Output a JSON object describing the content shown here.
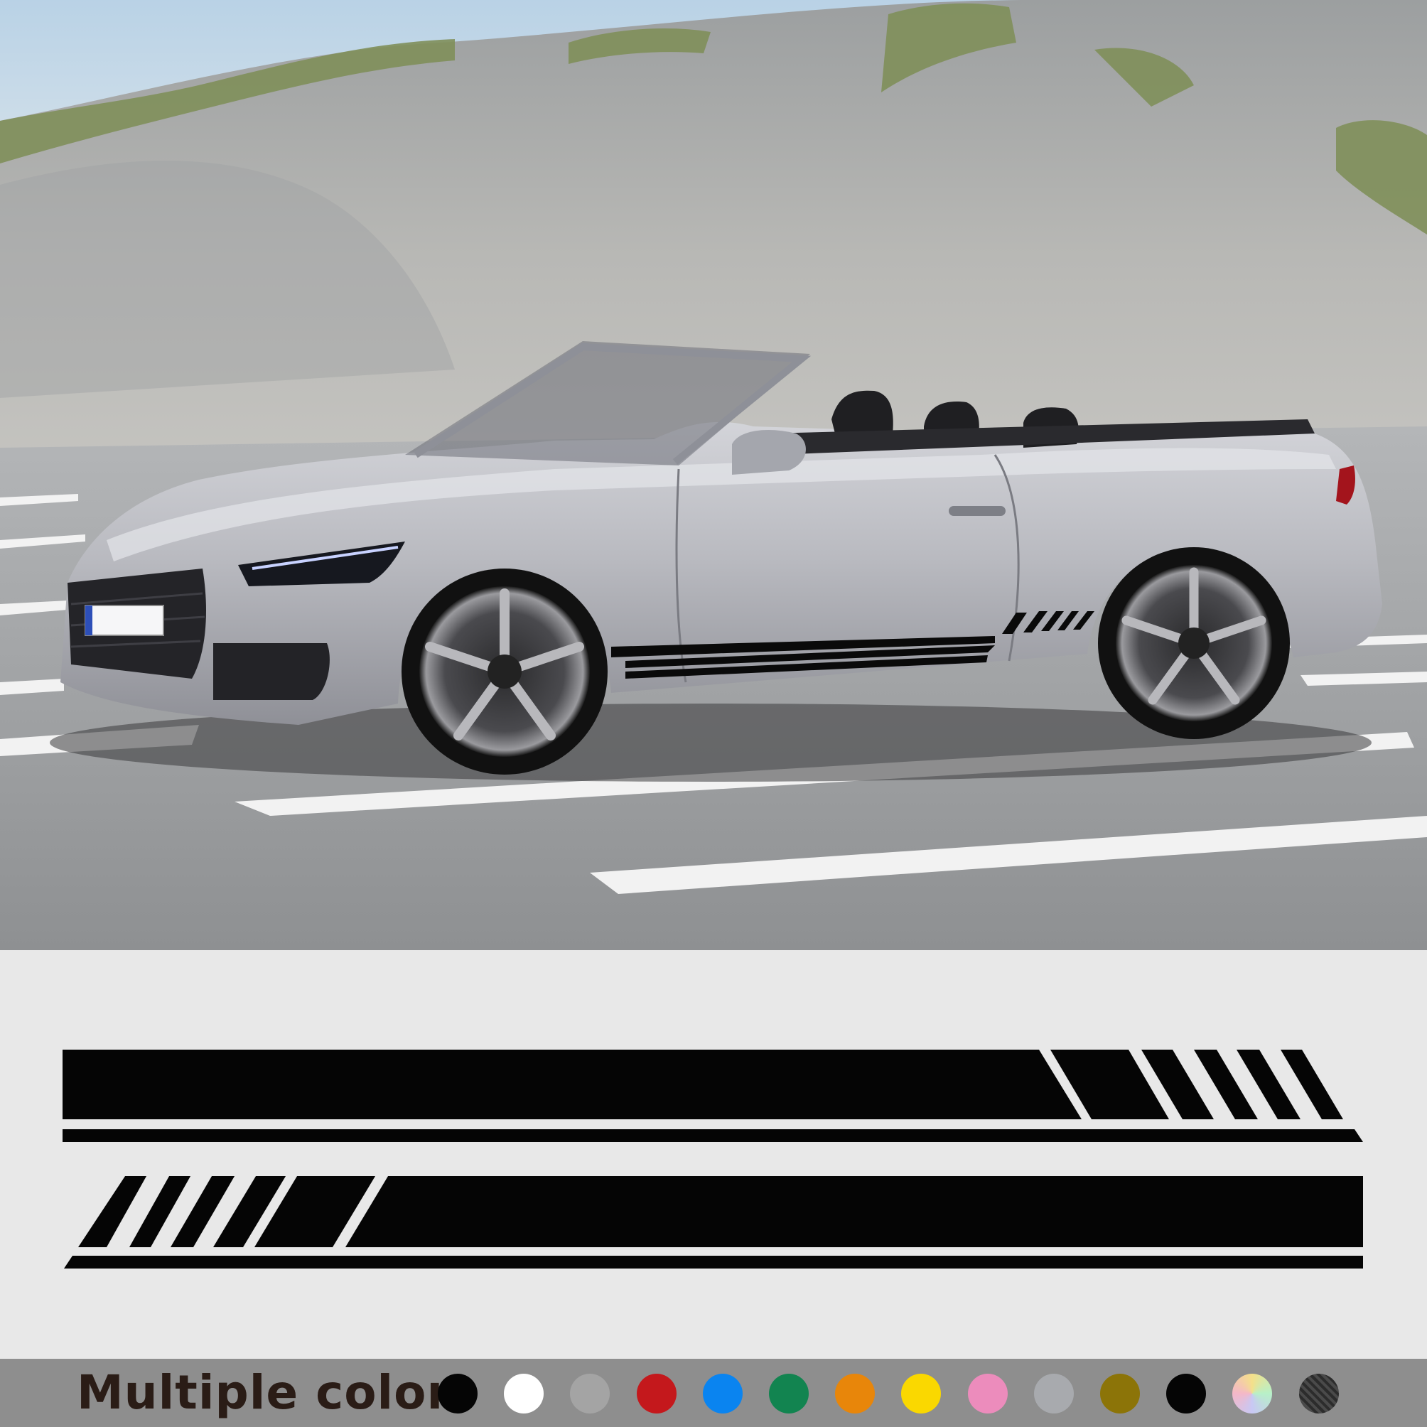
{
  "color_bar": {
    "label": "Multiple color",
    "swatches": [
      {
        "name": "black",
        "color": "#050505"
      },
      {
        "name": "white",
        "color": "#ffffff"
      },
      {
        "name": "grey",
        "color": "#a4a4a4"
      },
      {
        "name": "red",
        "color": "#c4181c"
      },
      {
        "name": "blue",
        "color": "#0a84f0"
      },
      {
        "name": "green",
        "color": "#128450"
      },
      {
        "name": "orange",
        "color": "#e8860a"
      },
      {
        "name": "yellow",
        "color": "#fad800"
      },
      {
        "name": "pink",
        "color": "#ec8cbc"
      },
      {
        "name": "silver",
        "color": "#a8aaae"
      },
      {
        "name": "gold",
        "color": "#8c7408"
      },
      {
        "name": "black-gloss",
        "color": "#050505"
      },
      {
        "name": "holographic",
        "color": "#e0d4a0"
      },
      {
        "name": "carbon-fiber",
        "color": "#3a3a3a"
      }
    ]
  }
}
